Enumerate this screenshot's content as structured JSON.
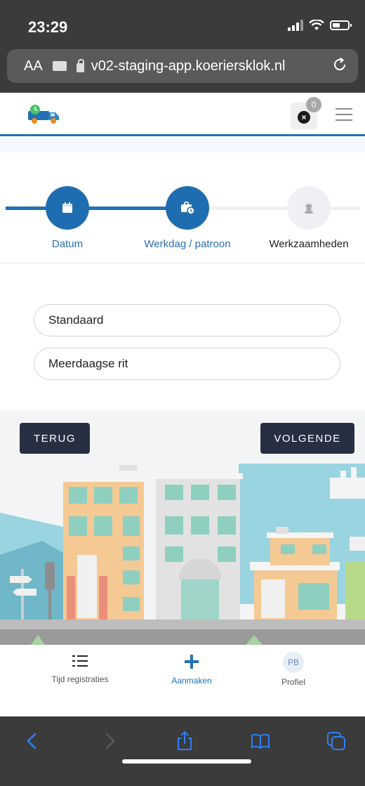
{
  "status_bar": {
    "time": "23:29"
  },
  "browser": {
    "aa_label": "AA",
    "url": "v02-staging-app.koeriersklok.nl"
  },
  "header": {
    "notification_count": "0",
    "notification_icon": "x-circle-icon",
    "menu_icon": "hamburger-icon"
  },
  "stepper": {
    "steps": [
      {
        "label": "Datum",
        "icon": "calendar-icon",
        "state": "done"
      },
      {
        "label": "Werkdag / patroon",
        "icon": "briefcase-clock-icon",
        "state": "active"
      },
      {
        "label": "Werkzaamheden",
        "icon": "worker-icon",
        "state": "pending"
      }
    ]
  },
  "options": {
    "items": [
      {
        "label": "Standaard"
      },
      {
        "label": "Meerdaagse rit"
      }
    ]
  },
  "navigation": {
    "back_label": "TERUG",
    "next_label": "VOLGENDE"
  },
  "tabbar": {
    "tabs": [
      {
        "label": "Tijd registraties",
        "icon": "list-icon"
      },
      {
        "label": "Aanmaken",
        "icon": "plus-icon",
        "active": true
      },
      {
        "label": "Profiel",
        "avatar_initials": "PB"
      }
    ]
  },
  "colors": {
    "primary": "#2271b3",
    "dark_button": "#263042",
    "browser_chrome": "#3b3b3b",
    "ios_blue": "#2f7ff6"
  }
}
